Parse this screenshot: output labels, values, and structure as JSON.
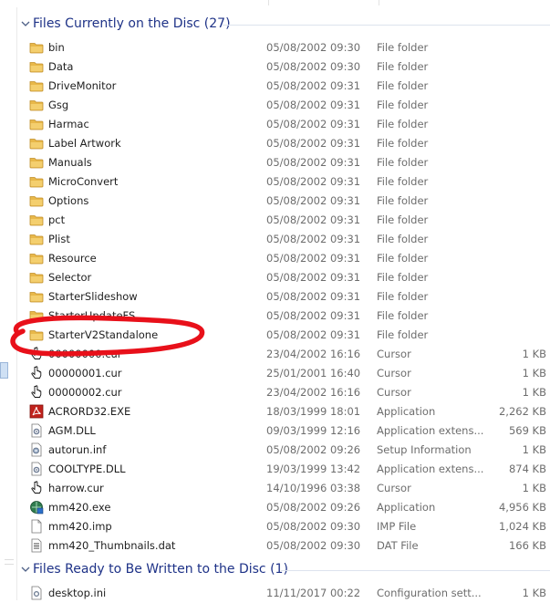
{
  "groups": [
    {
      "title": "Files Currently on the Disc (27)"
    },
    {
      "title": "Files Ready to Be Written to the Disc (1)"
    }
  ],
  "disc_files": [
    {
      "name": "bin",
      "date": "05/08/2002 09:30",
      "type": "File folder",
      "size": "",
      "icon": "folder-icon"
    },
    {
      "name": "Data",
      "date": "05/08/2002 09:30",
      "type": "File folder",
      "size": "",
      "icon": "folder-icon"
    },
    {
      "name": "DriveMonitor",
      "date": "05/08/2002 09:31",
      "type": "File folder",
      "size": "",
      "icon": "folder-icon"
    },
    {
      "name": "Gsg",
      "date": "05/08/2002 09:31",
      "type": "File folder",
      "size": "",
      "icon": "folder-icon"
    },
    {
      "name": "Harmac",
      "date": "05/08/2002 09:31",
      "type": "File folder",
      "size": "",
      "icon": "folder-icon"
    },
    {
      "name": "Label Artwork",
      "date": "05/08/2002 09:31",
      "type": "File folder",
      "size": "",
      "icon": "folder-icon"
    },
    {
      "name": "Manuals",
      "date": "05/08/2002 09:31",
      "type": "File folder",
      "size": "",
      "icon": "folder-icon"
    },
    {
      "name": "MicroConvert",
      "date": "05/08/2002 09:31",
      "type": "File folder",
      "size": "",
      "icon": "folder-icon"
    },
    {
      "name": "Options",
      "date": "05/08/2002 09:31",
      "type": "File folder",
      "size": "",
      "icon": "folder-icon"
    },
    {
      "name": "pct",
      "date": "05/08/2002 09:31",
      "type": "File folder",
      "size": "",
      "icon": "folder-icon"
    },
    {
      "name": "Plist",
      "date": "05/08/2002 09:31",
      "type": "File folder",
      "size": "",
      "icon": "folder-icon"
    },
    {
      "name": "Resource",
      "date": "05/08/2002 09:31",
      "type": "File folder",
      "size": "",
      "icon": "folder-icon"
    },
    {
      "name": "Selector",
      "date": "05/08/2002 09:31",
      "type": "File folder",
      "size": "",
      "icon": "folder-icon"
    },
    {
      "name": "StarterSlideshow",
      "date": "05/08/2002 09:31",
      "type": "File folder",
      "size": "",
      "icon": "folder-icon"
    },
    {
      "name": "StarterUpdateFS",
      "date": "05/08/2002 09:31",
      "type": "File folder",
      "size": "",
      "icon": "folder-icon"
    },
    {
      "name": "StarterV2Standalone",
      "date": "05/08/2002 09:31",
      "type": "File folder",
      "size": "",
      "icon": "folder-icon"
    },
    {
      "name": "00000000.cur",
      "date": "23/04/2002 16:16",
      "type": "Cursor",
      "size": "1 KB",
      "icon": "cursor-file-icon"
    },
    {
      "name": "00000001.cur",
      "date": "25/01/2001 16:40",
      "type": "Cursor",
      "size": "1 KB",
      "icon": "cursor-file-icon"
    },
    {
      "name": "00000002.cur",
      "date": "23/04/2002 16:16",
      "type": "Cursor",
      "size": "1 KB",
      "icon": "cursor-file-icon"
    },
    {
      "name": "ACRORD32.EXE",
      "date": "18/03/1999 18:01",
      "type": "Application",
      "size": "2,262 KB",
      "icon": "acrobat-exe-icon"
    },
    {
      "name": "AGM.DLL",
      "date": "09/03/1999 12:16",
      "type": "Application extens...",
      "size": "569 KB",
      "icon": "dll-file-icon"
    },
    {
      "name": "autorun.inf",
      "date": "05/08/2002 09:26",
      "type": "Setup Information",
      "size": "1 KB",
      "icon": "setup-info-icon"
    },
    {
      "name": "COOLTYPE.DLL",
      "date": "19/03/1999 13:42",
      "type": "Application extens...",
      "size": "874 KB",
      "icon": "dll-file-icon"
    },
    {
      "name": "harrow.cur",
      "date": "14/10/1996 03:38",
      "type": "Cursor",
      "size": "1 KB",
      "icon": "cursor-file-icon"
    },
    {
      "name": "mm420.exe",
      "date": "05/08/2002 09:26",
      "type": "Application",
      "size": "4,956 KB",
      "icon": "exe-app-icon"
    },
    {
      "name": "mm420.imp",
      "date": "05/08/2002 09:30",
      "type": "IMP File",
      "size": "1,024 KB",
      "icon": "blank-file-icon"
    },
    {
      "name": "mm420_Thumbnails.dat",
      "date": "05/08/2002 09:30",
      "type": "DAT File",
      "size": "166 KB",
      "icon": "dat-file-icon"
    }
  ],
  "pending_files": [
    {
      "name": "desktop.ini",
      "date": "11/11/2017 00:22",
      "type": "Configuration sett...",
      "size": "1 KB",
      "icon": "config-file-icon"
    }
  ],
  "colors": {
    "group_title": "#1e3287",
    "annotation_circle": "#e8101a",
    "folder": "#e8b84a"
  }
}
